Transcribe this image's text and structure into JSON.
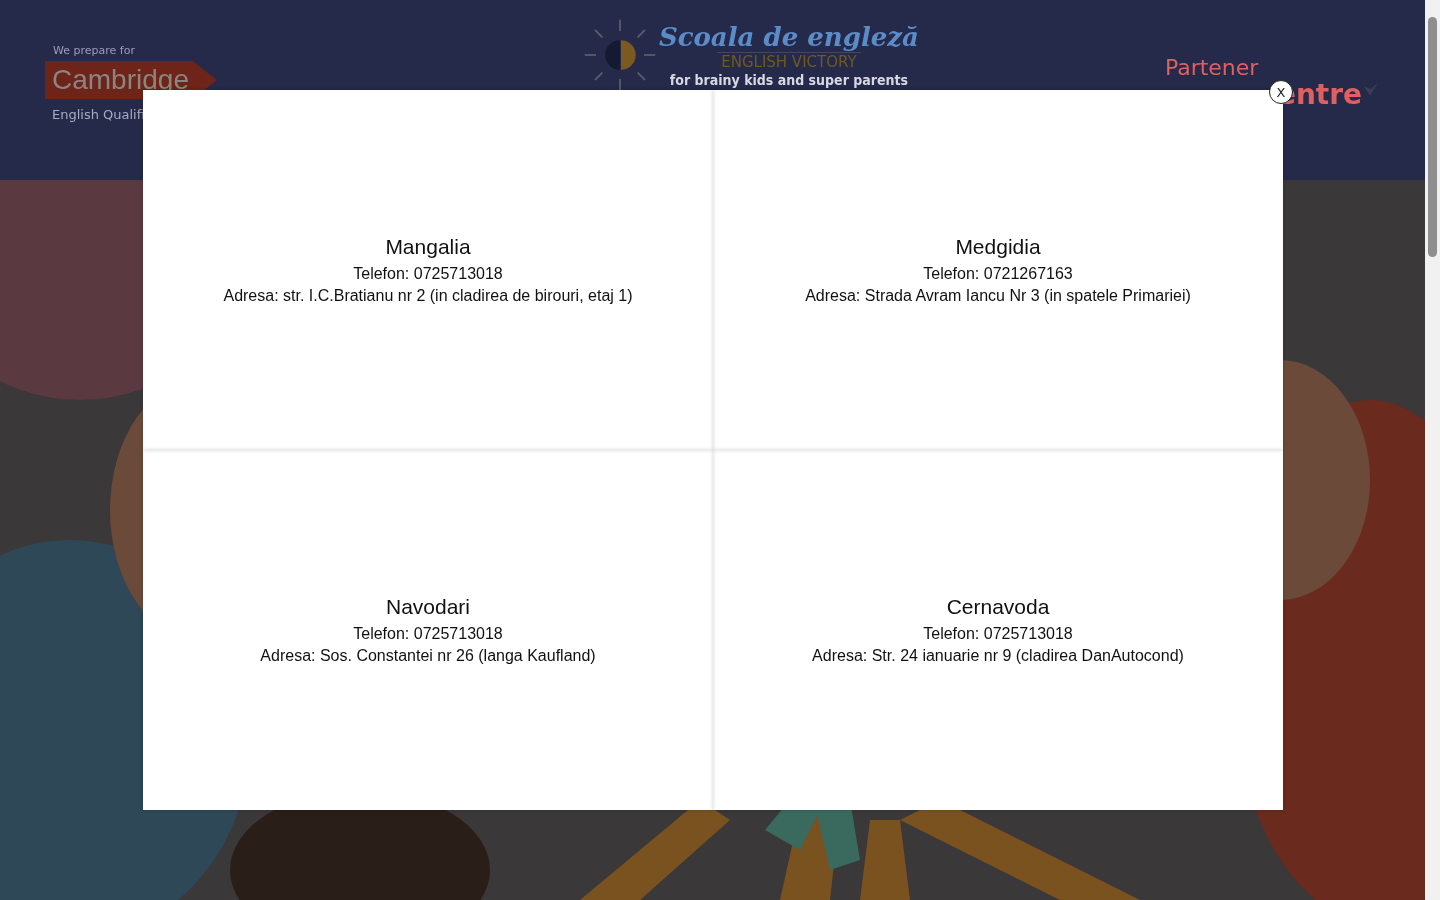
{
  "header": {
    "cambridge": {
      "tagline": "We prepare for",
      "brand": "Cambridge",
      "subtitle": "English Qualifi"
    },
    "logo": {
      "title": "Scoala de engleză",
      "name": "ENGLISH VICTORY",
      "slogan": "for brainy kids and super parents"
    },
    "partner": {
      "label": "Partener",
      "brand": "entre"
    }
  },
  "modal": {
    "close": "X",
    "locations": [
      {
        "city": "Mangalia",
        "phone": "Telefon: 0725713018",
        "address": "Adresa: str. I.C.Bratianu nr 2 (in cladirea de birouri, etaj 1)"
      },
      {
        "city": "Medgidia",
        "phone": "Telefon: 0721267163",
        "address": "Adresa: Strada Avram Iancu Nr 3 (in spatele Primariei)"
      },
      {
        "city": "Navodari",
        "phone": "Telefon: 0725713018",
        "address": "Adresa: Sos. Constantei nr 26 (langa Kaufland)"
      },
      {
        "city": "Cernavoda",
        "phone": "Telefon: 0725713018",
        "address": "Adresa: Str. 24 ianuarie nr 9 (cladirea DanAutocond)"
      }
    ]
  }
}
